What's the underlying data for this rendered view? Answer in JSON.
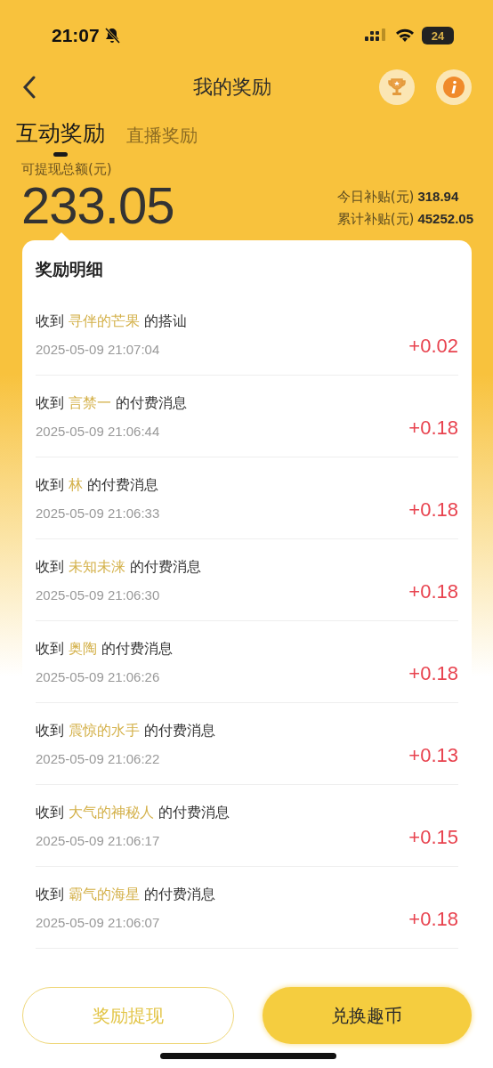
{
  "status_bar": {
    "time": "21:07",
    "silent": true,
    "battery": "24"
  },
  "nav": {
    "title": "我的奖励"
  },
  "tabs": [
    {
      "label": "互动奖励",
      "selected": true
    },
    {
      "label": "直播奖励",
      "selected": false
    }
  ],
  "summary": {
    "label": "可提现总额(元)",
    "amount": "233.05",
    "stats": [
      {
        "label": "今日补贴(元)",
        "value": "318.94"
      },
      {
        "label": "累计补贴(元)",
        "value": "45252.05"
      }
    ]
  },
  "details": {
    "title": "奖励明细",
    "items": [
      {
        "prefix": "收到",
        "sender": "寻伴的芒果",
        "suffix": "的搭讪",
        "time": "2025-05-09 21:07:04",
        "amount": "+0.02"
      },
      {
        "prefix": "收到",
        "sender": "言禁一",
        "suffix": "的付费消息",
        "time": "2025-05-09 21:06:44",
        "amount": "+0.18"
      },
      {
        "prefix": "收到",
        "sender": "林",
        "suffix": "的付费消息",
        "time": "2025-05-09 21:06:33",
        "amount": "+0.18"
      },
      {
        "prefix": "收到",
        "sender": "未知未涞",
        "suffix": "的付费消息",
        "time": "2025-05-09 21:06:30",
        "amount": "+0.18"
      },
      {
        "prefix": "收到",
        "sender": "奥陶",
        "suffix": "的付费消息",
        "time": "2025-05-09 21:06:26",
        "amount": "+0.18"
      },
      {
        "prefix": "收到",
        "sender": "震惊的水手",
        "suffix": "的付费消息",
        "time": "2025-05-09 21:06:22",
        "amount": "+0.13"
      },
      {
        "prefix": "收到",
        "sender": "大气的神秘人",
        "suffix": "的付费消息",
        "time": "2025-05-09 21:06:17",
        "amount": "+0.15"
      },
      {
        "prefix": "收到",
        "sender": "霸气的海星",
        "suffix": "的付费消息",
        "time": "2025-05-09 21:06:07",
        "amount": "+0.18"
      }
    ]
  },
  "actions": [
    {
      "label": "奖励提现",
      "kind": "outline"
    },
    {
      "label": "兑换趣币",
      "kind": "filled"
    }
  ]
}
